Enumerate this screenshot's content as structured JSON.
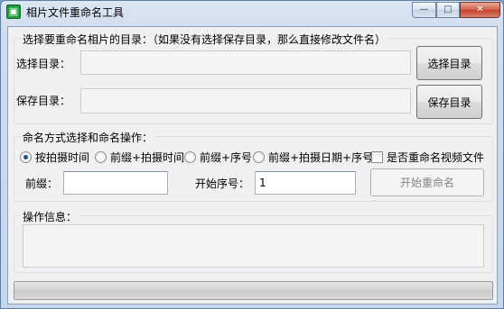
{
  "window": {
    "title": "相片文件重命名工具",
    "controls": {
      "minimize": "—",
      "maximize": "□",
      "close": "✕"
    }
  },
  "directory_group": {
    "title": "选择要重命名相片的目录：（如果没有选择保存目录，那么直接修改文件名）",
    "select_label": "选择目录：",
    "select_value": "",
    "select_button": "选择目录",
    "save_label": "保存目录：",
    "save_value": "",
    "save_button": "保存目录"
  },
  "naming_group": {
    "title": "命名方式选择和命名操作：",
    "options": [
      {
        "label": "按拍摄时间",
        "checked": true
      },
      {
        "label": "前缀+拍摄时间",
        "checked": false
      },
      {
        "label": "前缀+序号",
        "checked": false
      },
      {
        "label": "前缀+拍摄日期+序号",
        "checked": false
      }
    ],
    "rename_video_label": "是否重命名视频文件",
    "rename_video_checked": false,
    "prefix_label": "前缀：",
    "prefix_value": "",
    "start_index_label": "开始序号：",
    "start_index_value": "1",
    "start_button": "开始重命名"
  },
  "info_group": {
    "title": "操作信息：",
    "content": ""
  },
  "progress": {
    "value": 0
  },
  "colors": {
    "progress_fill": "#06b025",
    "radio_accent": "#1c4d8c"
  }
}
